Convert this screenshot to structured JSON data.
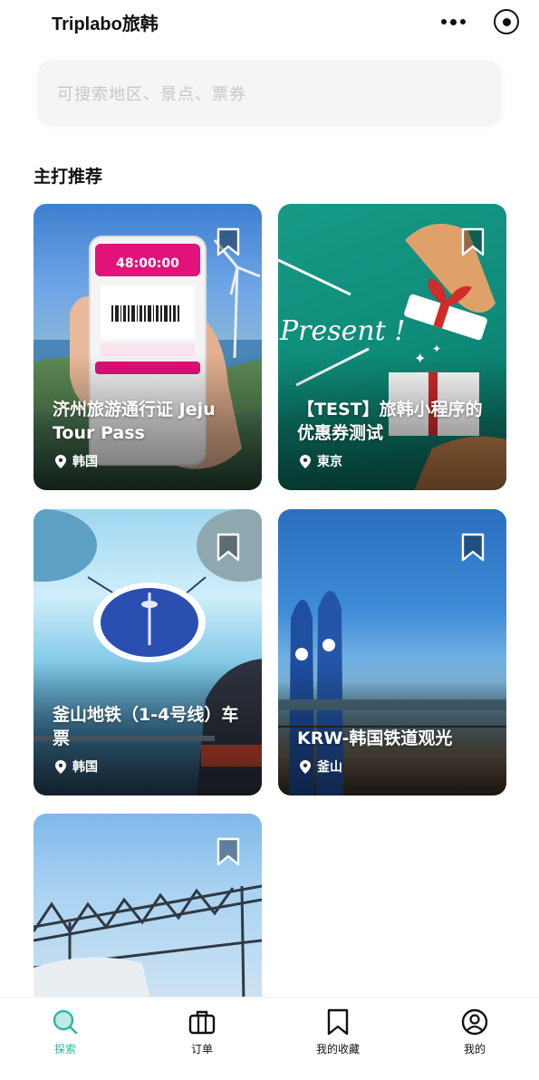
{
  "header": {
    "title": "Triplabo旅韩"
  },
  "search": {
    "placeholder": "可搜索地区、景点、票券"
  },
  "section": {
    "title": "主打推荐"
  },
  "cards": [
    {
      "title": "济州旅游通行证 Jeju Tour Pass",
      "location": "韩国",
      "visual": {
        "timer": "48:00:00"
      }
    },
    {
      "title": "【TEST】旅韩小程序的优惠券测试",
      "location": "東京",
      "visual": {
        "text": "Present !"
      }
    },
    {
      "title": "釜山地铁（1-4号线）车票",
      "location": "韩国"
    },
    {
      "title": "KRW-韩国铁道观光",
      "location": "釜山"
    },
    {
      "title": "",
      "location": ""
    }
  ],
  "nav": [
    {
      "label": "探索",
      "icon": "search-icon",
      "active": true
    },
    {
      "label": "订单",
      "icon": "briefcase-icon",
      "active": false
    },
    {
      "label": "我的收藏",
      "icon": "bookmark-icon",
      "active": false
    },
    {
      "label": "我的",
      "icon": "user-circle-icon",
      "active": false
    }
  ],
  "colors": {
    "accent": "#2fb6a3",
    "text": "#111111",
    "placeholder": "#c5c7ca"
  }
}
